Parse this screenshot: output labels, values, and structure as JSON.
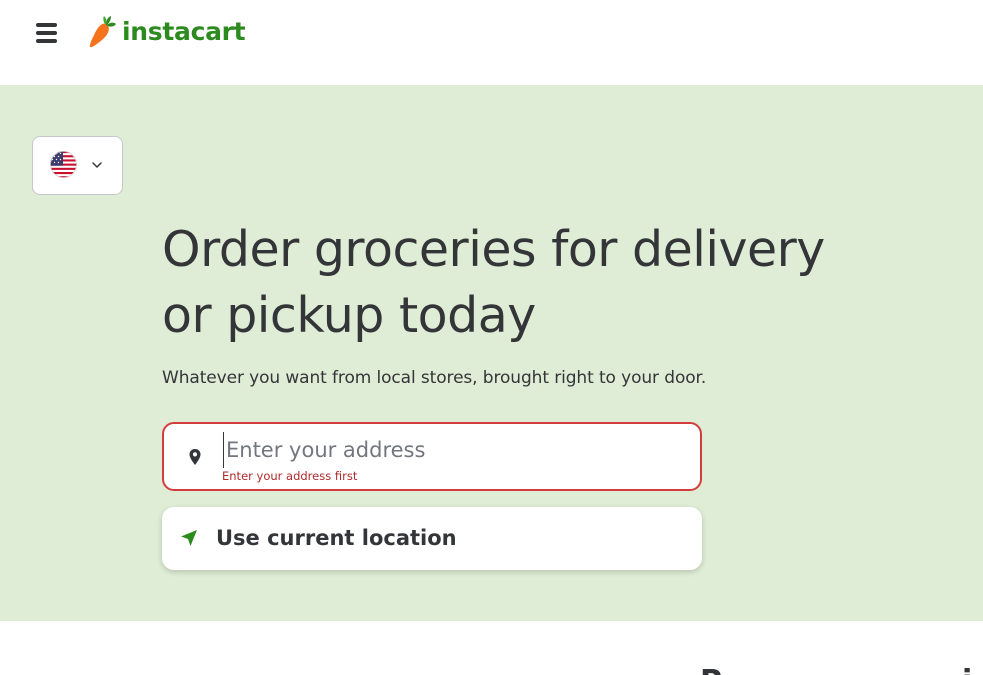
{
  "header": {
    "menu_icon": "hamburger-menu-icon",
    "logo_icon": "carrot-icon",
    "logo_text": "instacart",
    "brand_color": "#2c8a1e",
    "logo_accent": "#f4731c"
  },
  "hero": {
    "background": "#dfedd6",
    "locale": {
      "flag_icon": "us-flag-icon",
      "chevron_icon": "chevron-down-icon"
    },
    "headline": "Order groceries for delivery or pickup today",
    "subtext": "Whatever you want from local stores, brought right to your door.",
    "address": {
      "placeholder": "Enter your address",
      "value": "",
      "error": "Enter your address first",
      "icon": "map-pin-icon",
      "error_color": "#d43c3c"
    },
    "current_location": {
      "label": "Use current location",
      "icon": "navigation-arrow-icon"
    }
  }
}
